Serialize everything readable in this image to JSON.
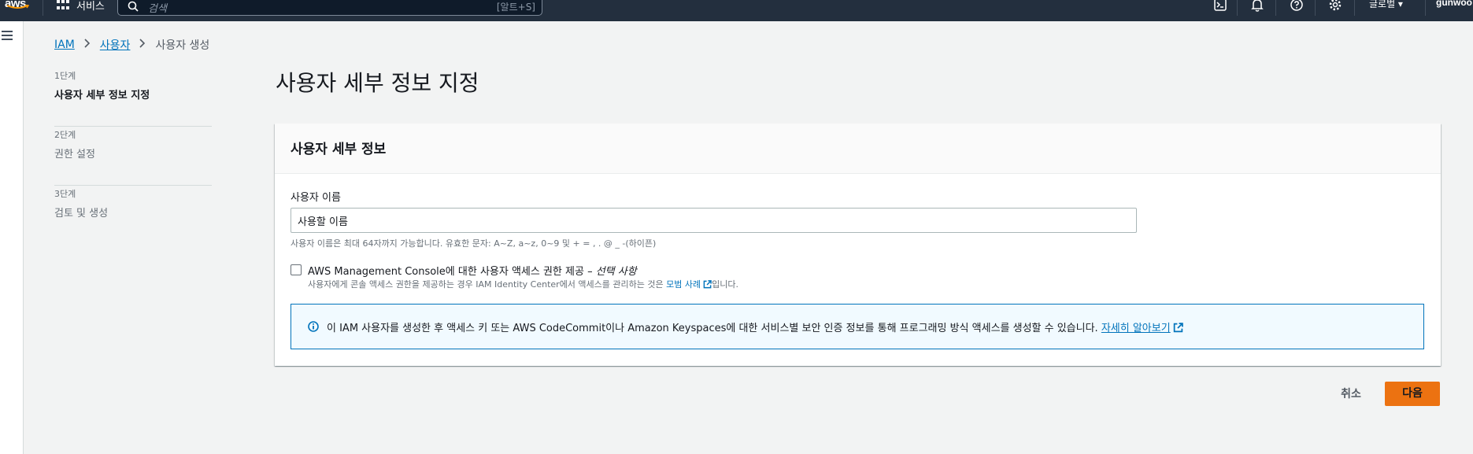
{
  "topbar": {
    "logo_text": "aws",
    "services_label": "서비스",
    "search_placeholder": "검색",
    "search_shortcut": "[알트+S]",
    "region_label": "글로벌 ▾",
    "account_label": "gunwoo",
    "icons": [
      "cloudshell-icon",
      "bell-icon",
      "help-icon",
      "settings-icon"
    ]
  },
  "breadcrumb": {
    "items": [
      "IAM",
      "사용자",
      "사용자 생성"
    ]
  },
  "steps": [
    {
      "num": "1단계",
      "name": "사용자 세부 정보 지정",
      "active": true
    },
    {
      "num": "2단계",
      "name": "권한 설정",
      "active": false
    },
    {
      "num": "3단계",
      "name": "검토 및 생성",
      "active": false
    }
  ],
  "page_title": "사용자 세부 정보 지정",
  "panel": {
    "title": "사용자 세부 정보",
    "username_label": "사용자 이름",
    "username_value": "사용할 이름",
    "username_help": "사용자 이름은 최대 64자까지 가능합니다. 유효한 문자: A~Z, a~z, 0~9 및 + = , . @ _ -(하이픈)",
    "console_access_label": "AWS Management Console에 대한 사용자 액세스 권한 제공 – ",
    "console_access_optional": "선택 사항",
    "console_access_desc_pre": "사용자에게 콘솔 액세스 권한을 제공하는 경우 IAM Identity Center에서 액세스를 관리하는 것은 ",
    "console_access_desc_link": "모범 사례",
    "console_access_desc_post": "입니다.",
    "info_text": "이 IAM 사용자를 생성한 후 액세스 키 또는 AWS CodeCommit이나 Amazon Keyspaces에 대한 서비스별 보안 인증 정보를 통해 프로그래밍 방식 액세스를 생성할 수 있습니다. ",
    "info_link": "자세히 알아보기"
  },
  "actions": {
    "cancel_label": "취소",
    "next_label": "다음"
  },
  "colors": {
    "topbar_bg": "#232f3e",
    "link": "#0073bb",
    "primary_button": "#ec7211",
    "info_bg": "#f1faff"
  }
}
